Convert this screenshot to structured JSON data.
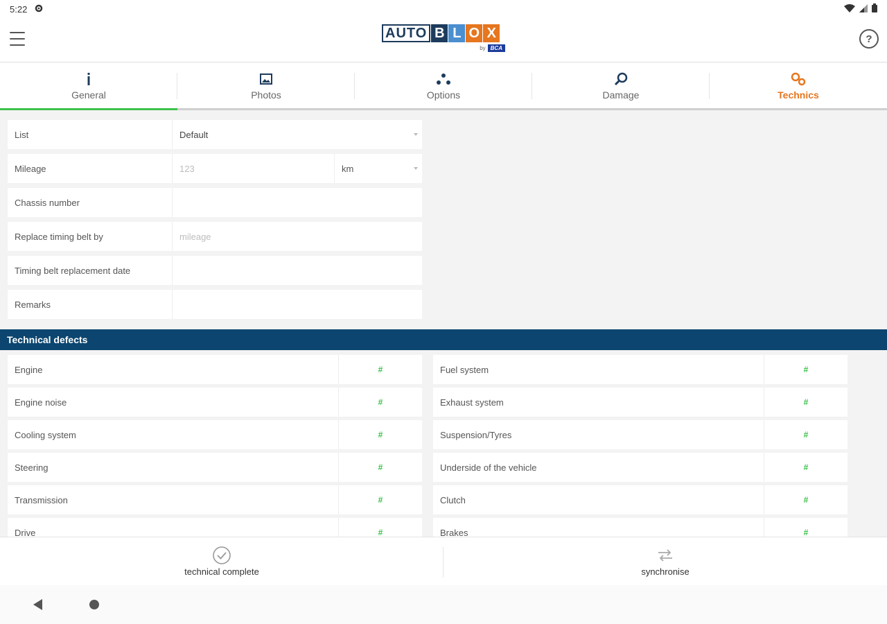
{
  "statusbar": {
    "time": "5:22"
  },
  "logo": {
    "auto": "AUTO",
    "tiles": [
      "B",
      "L",
      "O",
      "X"
    ],
    "by": "by",
    "brand": "BCA"
  },
  "tile_colors": [
    "#1d3b5c",
    "#4a8fcf",
    "#e6761f",
    "#e6761f"
  ],
  "tabs": [
    {
      "label": "General",
      "icon": "info-icon"
    },
    {
      "label": "Photos",
      "icon": "photo-icon"
    },
    {
      "label": "Options",
      "icon": "options-icon"
    },
    {
      "label": "Damage",
      "icon": "search-icon"
    },
    {
      "label": "Technics",
      "icon": "gears-icon"
    }
  ],
  "form": {
    "list": {
      "label": "List",
      "value": "Default"
    },
    "mileage": {
      "label": "Mileage",
      "placeholder": "123",
      "unit": "km"
    },
    "chassis": {
      "label": "Chassis number",
      "value": ""
    },
    "timing_belt": {
      "label": "Replace timing belt by",
      "placeholder": "mileage"
    },
    "timing_date": {
      "label": "Timing belt replacement date",
      "value": ""
    },
    "remarks": {
      "label": "Remarks",
      "value": ""
    }
  },
  "section": {
    "title": "Technical defects"
  },
  "defects": {
    "mark": "#",
    "left": [
      "Engine",
      "Engine noise",
      "Cooling system",
      "Steering",
      "Transmission",
      "Drive"
    ],
    "right": [
      "Fuel system",
      "Exhaust system",
      "Suspension/Tyres",
      "Underside of the vehicle",
      "Clutch",
      "Brakes"
    ]
  },
  "actions": {
    "complete": "technical complete",
    "sync": "synchronise"
  },
  "colors": {
    "accent_orange": "#e6761f",
    "section_blue": "#0c4670",
    "active_green": "#3cc24a"
  }
}
